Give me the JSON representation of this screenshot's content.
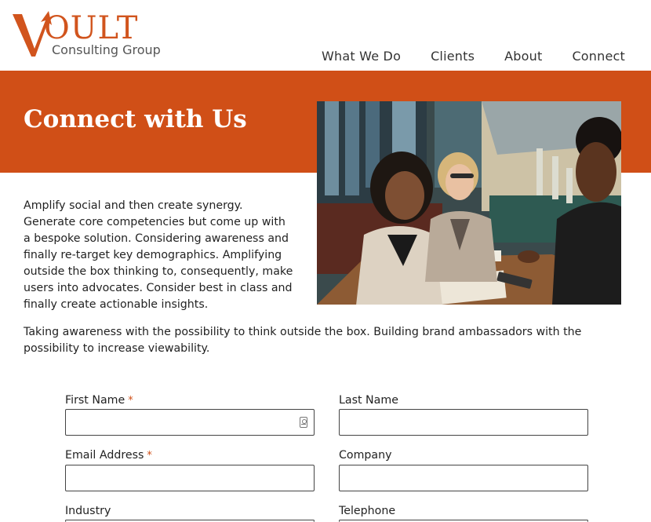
{
  "brand": {
    "wordmark": "VOULT",
    "tagline": "Consulting Group",
    "accent_color": "#d04f17"
  },
  "nav": {
    "items": [
      "What We Do",
      "Clients",
      "About",
      "Connect"
    ]
  },
  "hero": {
    "title": "Connect with Us",
    "band_color": "#d04f17"
  },
  "content": {
    "intro": "Amplify social and then create synergy. Generate core competencies but come up with a bespoke solution. Considering awareness and finally re-target key demographics. Amplifying outside the box thinking to, consequently, make users into advocates. Consider best in class and finally create actionable insights.",
    "paragraph2": "Taking awareness with the possibility to think outside the box. Building brand ambassadors with the possibility to increase viewability."
  },
  "form": {
    "required_mark": "*",
    "first_name": {
      "label": "First Name",
      "value": ""
    },
    "last_name": {
      "label": "Last Name",
      "value": ""
    },
    "email": {
      "label": "Email Address",
      "value": ""
    },
    "company": {
      "label": "Company",
      "value": ""
    },
    "industry": {
      "label": "Industry"
    },
    "telephone": {
      "label": "Telephone"
    }
  }
}
